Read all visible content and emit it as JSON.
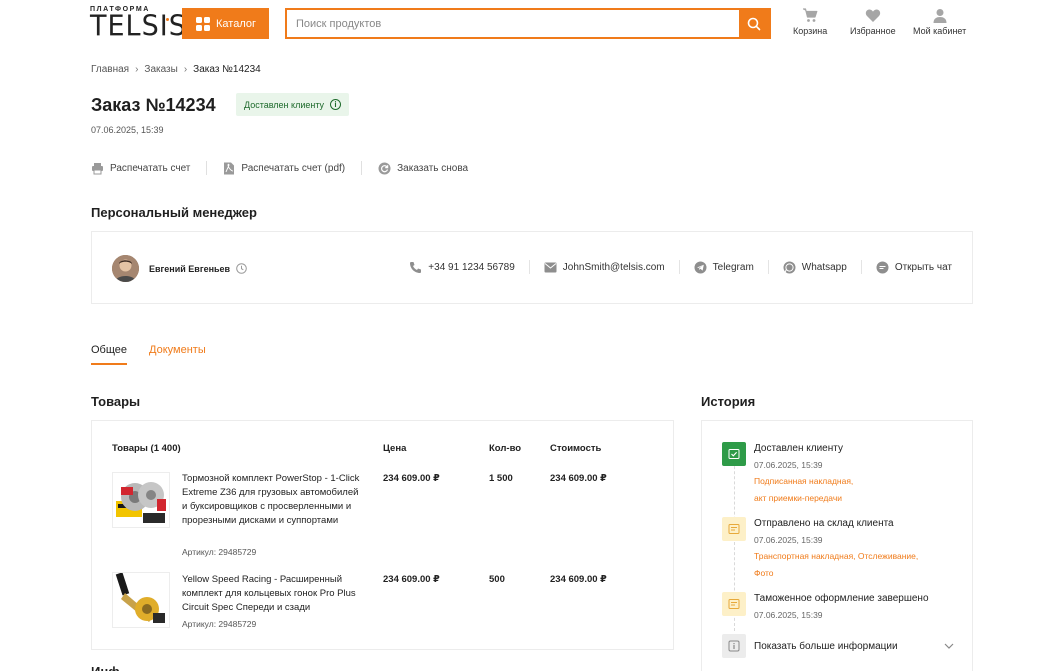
{
  "header": {
    "logo_small": "ПЛАТФОРМА",
    "logo_big": "TELSIS",
    "catalog_label": "Каталог",
    "search_placeholder": "Поиск продуктов",
    "cart_label": "Корзина",
    "favorites_label": "Избранное",
    "account_label": "Мой кабинет"
  },
  "breadcrumb": [
    "Главная",
    "Заказы",
    "Заказ №14234"
  ],
  "order": {
    "title": "Заказ №14234",
    "status": "Доставлен клиенту",
    "date": "07.06.2025, 15:39"
  },
  "actions": {
    "print_invoice": "Распечатать счет",
    "print_pdf": "Распечатать счет (pdf)",
    "reorder": "Заказать снова"
  },
  "manager": {
    "section_title": "Персональный менеджер",
    "name": "Евгений Евгеньев",
    "phone": "+34 91 1234 56789",
    "email": "JohnSmith@telsis.com",
    "telegram": "Telegram",
    "whatsapp": "Whatsapp",
    "chat": "Открыть чат"
  },
  "tabs": [
    "Общее",
    "Документы"
  ],
  "goods": {
    "section_title": "Товары",
    "columns": [
      "Товары (1 400)",
      "Цена",
      "Кол-во",
      "Стоимость"
    ],
    "items": [
      {
        "name": "Тормозной комплект PowerStop - 1-Click Extreme Z36 для грузовых автомобилей и буксировщиков с просверленными и прорезными дисками и суппортами",
        "sku": "Артикул: 29485729",
        "price": "234 609.00 ₽",
        "qty": "1 500",
        "total": "234 609.00 ₽"
      },
      {
        "name": "Yellow Speed Racing - Расширенный комплект для кольцевых гонок Pro Plus Circuit Spec Спереди и сзади",
        "sku": "Артикул: 29485729",
        "price": "234 609.00 ₽",
        "qty": "500",
        "total": "234 609.00 ₽"
      }
    ]
  },
  "history": {
    "section_title": "История",
    "events": [
      {
        "title": "Доставлен клиенту",
        "date": "07.06.2025, 15:39",
        "links": [
          "Подписанная накладная,",
          "акт приемки-передачи"
        ]
      },
      {
        "title": "Отправлено на склад клиента",
        "date": "07.06.2025, 15:39",
        "links": [
          "Транспортная накладная,  Отслеживание,",
          "Фото"
        ]
      },
      {
        "title": "Таможенное оформление завершено",
        "date": "07.06.2025, 15:39",
        "links": []
      }
    ],
    "more_label": "Показать больше информации"
  },
  "colors": {
    "accent": "#f07b1a",
    "status_bg": "#e9f5ea",
    "status_text": "#1e6b2c",
    "done_icon": "#2e9b48",
    "pending_icon": "#fdf0c8"
  }
}
